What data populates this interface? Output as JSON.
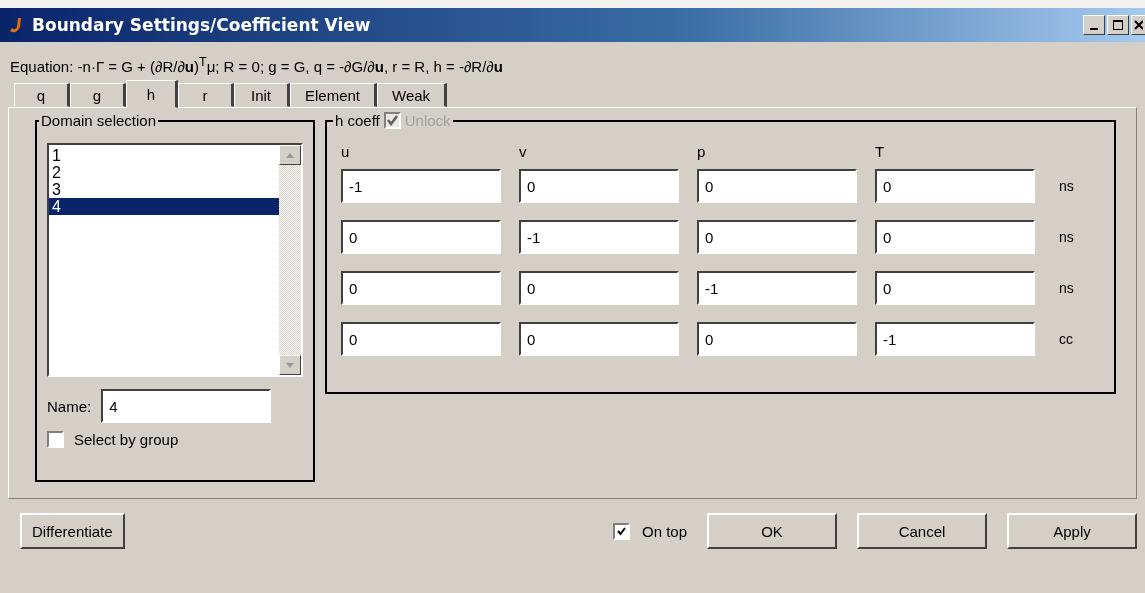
{
  "window": {
    "title": "Boundary Settings/Coefficient View"
  },
  "equation": "Equation: -n·Γ = G + (∂R/∂**u**)$^{T}$μ; R = 0; g = G, q = -∂G/∂**u**, r = R, h = -∂R/∂**u**",
  "tabs": [
    {
      "label": "q",
      "selected": false
    },
    {
      "label": "g",
      "selected": false
    },
    {
      "label": "h",
      "selected": true
    },
    {
      "label": "r",
      "selected": false
    },
    {
      "label": "Init",
      "selected": false
    },
    {
      "label": "Element",
      "selected": false
    },
    {
      "label": "Weak",
      "selected": false
    }
  ],
  "domain_selection": {
    "title": "Domain selection",
    "items": [
      {
        "label": "1",
        "selected": false
      },
      {
        "label": "2",
        "selected": false
      },
      {
        "label": "3",
        "selected": false
      },
      {
        "label": "4",
        "selected": true
      }
    ],
    "name_label": "Name:",
    "name_value": "4",
    "select_by_group": {
      "label": "Select by group",
      "checked": false
    }
  },
  "coefficients": {
    "title": "h coeff",
    "unlock": {
      "label": "Unlock",
      "checked": true,
      "disabled": true
    },
    "columns": [
      "u",
      "v",
      "p",
      "T"
    ],
    "rows": [
      {
        "values": [
          "-1",
          "0",
          "0",
          "0"
        ],
        "unit": "ns"
      },
      {
        "values": [
          "0",
          "-1",
          "0",
          "0"
        ],
        "unit": "ns"
      },
      {
        "values": [
          "0",
          "0",
          "-1",
          "0"
        ],
        "unit": "ns"
      },
      {
        "values": [
          "0",
          "0",
          "0",
          "-1"
        ],
        "unit": "cc"
      }
    ]
  },
  "buttons": {
    "differentiate": "Differentiate",
    "on_top": {
      "label": "On top",
      "checked": true
    },
    "ok": "OK",
    "cancel": "Cancel",
    "apply": "Apply"
  }
}
